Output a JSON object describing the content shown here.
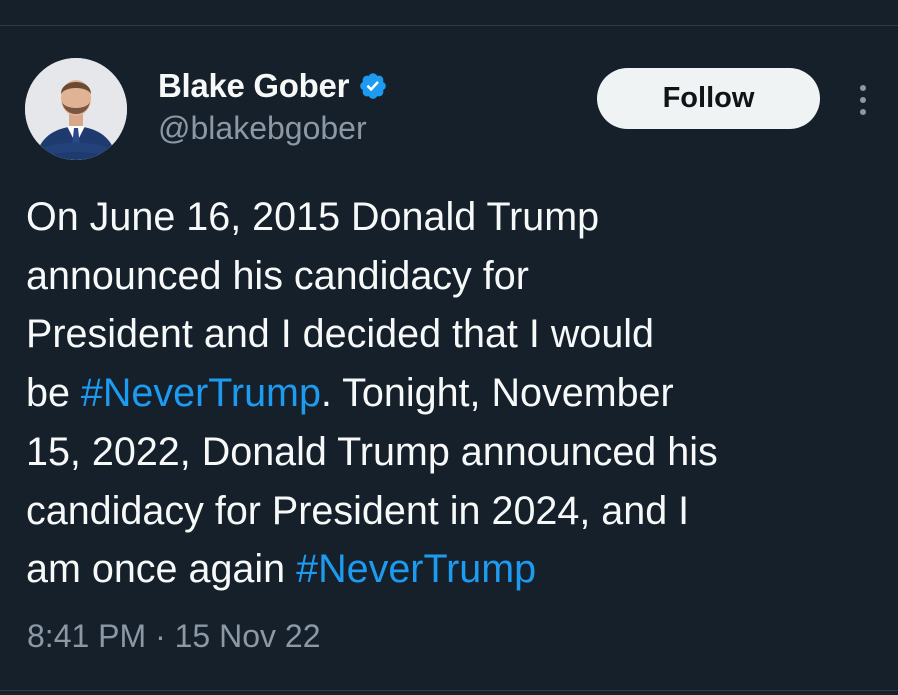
{
  "author": {
    "display_name": "Blake Gober",
    "handle": "@blakebgober",
    "verified_icon": "verified-badge-icon",
    "avatar_icon": "avatar-photo"
  },
  "actions": {
    "follow_label": "Follow",
    "more_icon": "more-vertical-icon"
  },
  "tweet": {
    "lines": [
      [
        {
          "text": "On June 16, 2015 Donald Trump"
        }
      ],
      [
        {
          "text": "announced his candidacy for"
        }
      ],
      [
        {
          "text": "President and I decided that I would"
        }
      ],
      [
        {
          "text": "be "
        },
        {
          "text": "#NeverTrump",
          "hashtag": true
        },
        {
          "text": ". Tonight, November"
        }
      ],
      [
        {
          "text": "15, 2022, Donald Trump announced his"
        }
      ],
      [
        {
          "text": "candidacy for President in 2024, and I"
        }
      ],
      [
        {
          "text": "am once again "
        },
        {
          "text": "#NeverTrump",
          "hashtag": true
        }
      ]
    ],
    "timestamp": "8:41 PM · 15 Nov 22"
  },
  "colors": {
    "background": "#15202b",
    "text": "#f7f9f9",
    "secondary_text": "#8b98a5",
    "accent": "#1d9bf0",
    "button_bg": "#eff3f4"
  }
}
